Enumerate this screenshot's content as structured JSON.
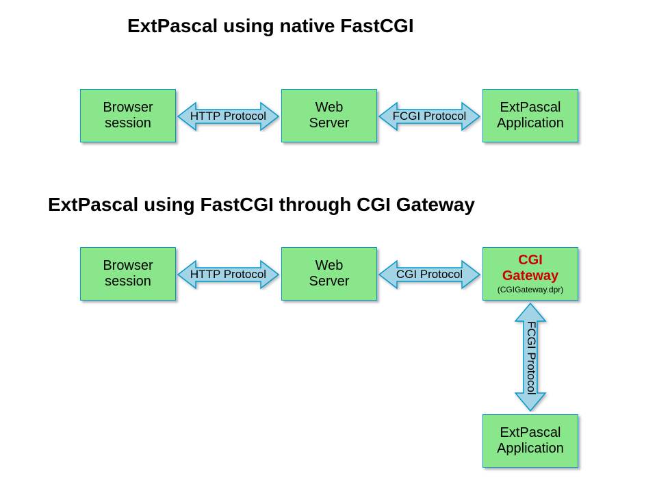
{
  "diagram1": {
    "title": "ExtPascal using native FastCGI",
    "box1_line1": "Browser",
    "box1_line2": "session",
    "arrow1_label": "HTTP Protocol",
    "box2_line1": "Web",
    "box2_line2": "Server",
    "arrow2_label": "FCGI Protocol",
    "box3_line1": "ExtPascal",
    "box3_line2": "Application"
  },
  "diagram2": {
    "title": "ExtPascal using FastCGI through CGI Gateway",
    "box1_line1": "Browser",
    "box1_line2": "session",
    "arrow1_label": "HTTP Protocol",
    "box2_line1": "Web",
    "box2_line2": "Server",
    "arrow2_label": "CGI Protocol",
    "box3_line1": "CGI",
    "box3_line2": "Gateway",
    "box3_sub": "(CGIGateway.dpr)",
    "arrow3_label": "FCGI Protocol",
    "box4_line1": "ExtPascal",
    "box4_line2": "Application"
  }
}
